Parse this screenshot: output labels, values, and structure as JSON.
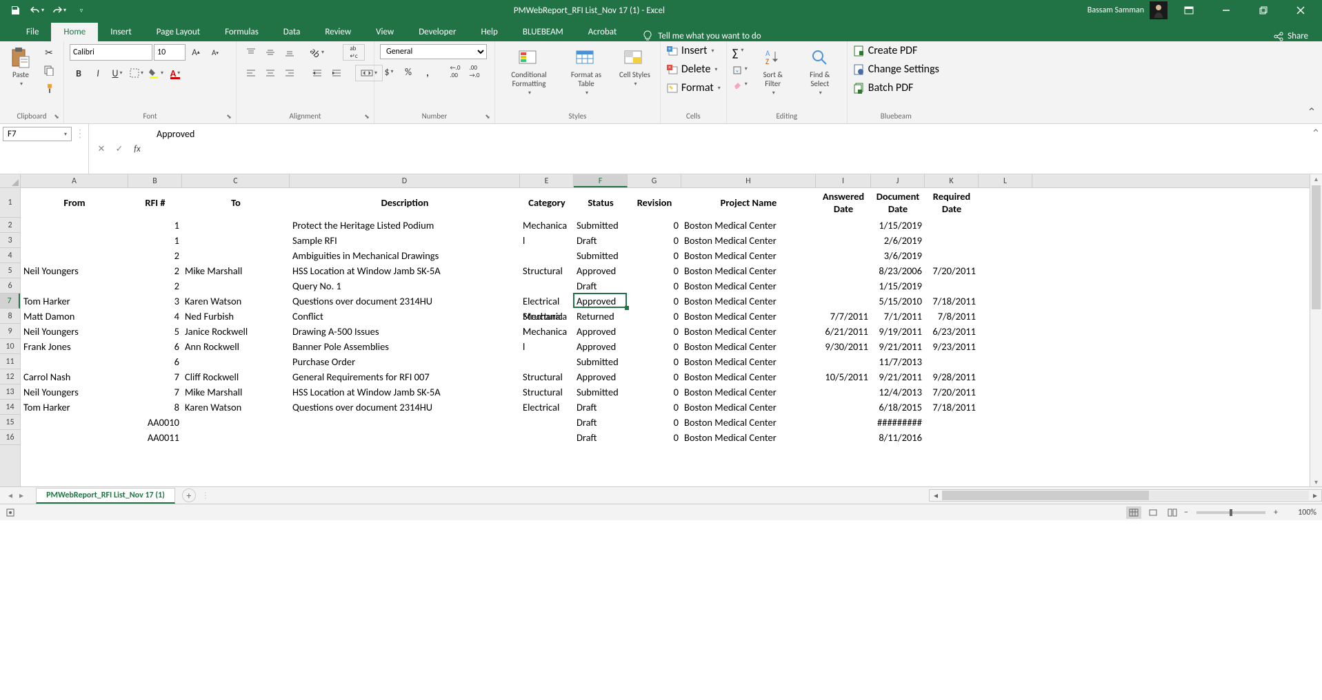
{
  "title": "PMWebReport_RFI List_Nov 17 (1)  -  Excel",
  "user": "Bassam Samman",
  "ribbon_tabs": [
    "File",
    "Home",
    "Insert",
    "Page Layout",
    "Formulas",
    "Data",
    "Review",
    "View",
    "Developer",
    "Help",
    "BLUEBEAM",
    "Acrobat"
  ],
  "active_tab": 1,
  "tell_me": "Tell me what you want to do",
  "share": "Share",
  "groups": {
    "clipboard": {
      "label": "Clipboard",
      "paste": "Paste"
    },
    "font": {
      "label": "Font",
      "name": "Calibri",
      "size": "10"
    },
    "alignment": {
      "label": "Alignment"
    },
    "number": {
      "label": "Number",
      "format": "General"
    },
    "styles": {
      "label": "Styles",
      "cf": "Conditional Formatting",
      "ft": "Format as Table",
      "cs": "Cell Styles"
    },
    "cells": {
      "label": "Cells",
      "insert": "Insert",
      "delete": "Delete",
      "format": "Format"
    },
    "editing": {
      "label": "Editing",
      "sort": "Sort & Filter",
      "find": "Find & Select"
    },
    "bluebeam": {
      "label": "Bluebeam",
      "create": "Create PDF",
      "change": "Change Settings",
      "batch": "Batch PDF"
    }
  },
  "namebox": "F7",
  "formula": "Approved",
  "columns": [
    "A",
    "B",
    "C",
    "D",
    "E",
    "F",
    "G",
    "H",
    "I",
    "J",
    "K",
    "L"
  ],
  "headers": [
    "From",
    "RFI #",
    "To",
    "Description",
    "Category",
    "Status",
    "Revision",
    "Project Name",
    "Answered Date",
    "Document Date",
    "Required Date"
  ],
  "rows": [
    {
      "n": 2,
      "A": "",
      "B": "1",
      "D": "Protect the Heritage Listed Podium",
      "F": "Submitted",
      "G": "0",
      "H": "Boston Medical Center",
      "J": "1/15/2019"
    },
    {
      "n": 3,
      "A": "",
      "B": "1",
      "D": "Sample RFI",
      "E": "Mechanical",
      "F": "Draft",
      "G": "0",
      "H": "Boston Medical Center",
      "J": "2/6/2019"
    },
    {
      "n": 4,
      "A": "",
      "B": "2",
      "D": "Ambiguities in Mechanical Drawings",
      "F": "Submitted",
      "G": "0",
      "H": "Boston Medical Center",
      "J": "3/6/2019"
    },
    {
      "n": 5,
      "A": "Neil Youngers",
      "B": "2",
      "C": "Mike Marshall",
      "D": "HSS Location at Window Jamb SK-5A",
      "E": "Structural",
      "F": "Approved",
      "G": "0",
      "H": "Boston Medical Center",
      "J": "8/23/2006",
      "K": "7/20/2011"
    },
    {
      "n": 6,
      "A": "",
      "B": "2",
      "D": "Query No. 1",
      "F": "Draft",
      "G": "0",
      "H": "Boston Medical Center",
      "J": "1/15/2019"
    },
    {
      "n": 7,
      "A": "Tom Harker",
      "B": "3",
      "C": "Karen Watson",
      "D": "Questions over document 2314HU",
      "E": "Electrical",
      "F": "Approved",
      "G": "0",
      "H": "Boston Medical Center",
      "J": "5/15/2010",
      "K": "7/18/2011"
    },
    {
      "n": 8,
      "A": "Matt Damon",
      "B": "4",
      "C": "Ned Furbish",
      "D": "Conflict",
      "E": "Structural",
      "F": "Returned",
      "G": "0",
      "H": "Boston Medical Center",
      "I": "7/7/2011",
      "J": "7/1/2011",
      "K": "7/8/2011"
    },
    {
      "n": 9,
      "A": "Neil Youngers",
      "B": "5",
      "C": "Janice Rockwell",
      "D": "Drawing A-500 Issues",
      "E": "Mechanical",
      "F": "Approved",
      "G": "0",
      "H": "Boston Medical Center",
      "I": "6/21/2011",
      "J": "9/19/2011",
      "K": "6/23/2011"
    },
    {
      "n": 10,
      "A": "Frank Jones",
      "B": "6",
      "C": "Ann Rockwell",
      "D": "Banner Pole Assemblies",
      "E": "Mechanical",
      "F": "Approved",
      "G": "0",
      "H": "Boston Medical Center",
      "I": "9/30/2011",
      "J": "9/21/2011",
      "K": "9/23/2011"
    },
    {
      "n": 11,
      "A": "",
      "B": "6",
      "D": "Purchase Order",
      "F": "Submitted",
      "G": "0",
      "H": "Boston Medical Center",
      "J": "11/7/2013"
    },
    {
      "n": 12,
      "A": "Carrol Nash",
      "B": "7",
      "C": "Cliff Rockwell",
      "D": "General Requirements for RFI 007",
      "E": "Structural",
      "F": "Approved",
      "G": "0",
      "H": "Boston Medical Center",
      "I": "10/5/2011",
      "J": "9/21/2011",
      "K": "9/28/2011"
    },
    {
      "n": 13,
      "A": "Neil Youngers",
      "B": "7",
      "C": "Mike Marshall",
      "D": "HSS Location at Window Jamb SK-5A",
      "E": "Structural",
      "F": "Submitted",
      "G": "0",
      "H": "Boston Medical Center",
      "J": "12/4/2013",
      "K": "7/20/2011"
    },
    {
      "n": 14,
      "A": "Tom Harker",
      "B": "8",
      "C": "Karen Watson",
      "D": "Questions over document 2314HU",
      "E": "Electrical",
      "F": "Draft",
      "G": "0",
      "H": "Boston Medical Center",
      "J": "6/18/2015",
      "K": "7/18/2011"
    },
    {
      "n": 15,
      "A": "",
      "B": "AA0010",
      "F": "Draft",
      "G": "0",
      "H": "Boston Medical Center",
      "J": "#########"
    },
    {
      "n": 16,
      "A": "",
      "B": "AA0011",
      "F": "Draft",
      "G": "0",
      "H": "Boston Medical Center",
      "J": "8/11/2016"
    }
  ],
  "selected": {
    "row": 7,
    "col": "F"
  },
  "sheet_tab": "PMWebReport_RFI List_Nov 17 (1)",
  "status": {
    "ready": "",
    "zoom": "100%"
  }
}
